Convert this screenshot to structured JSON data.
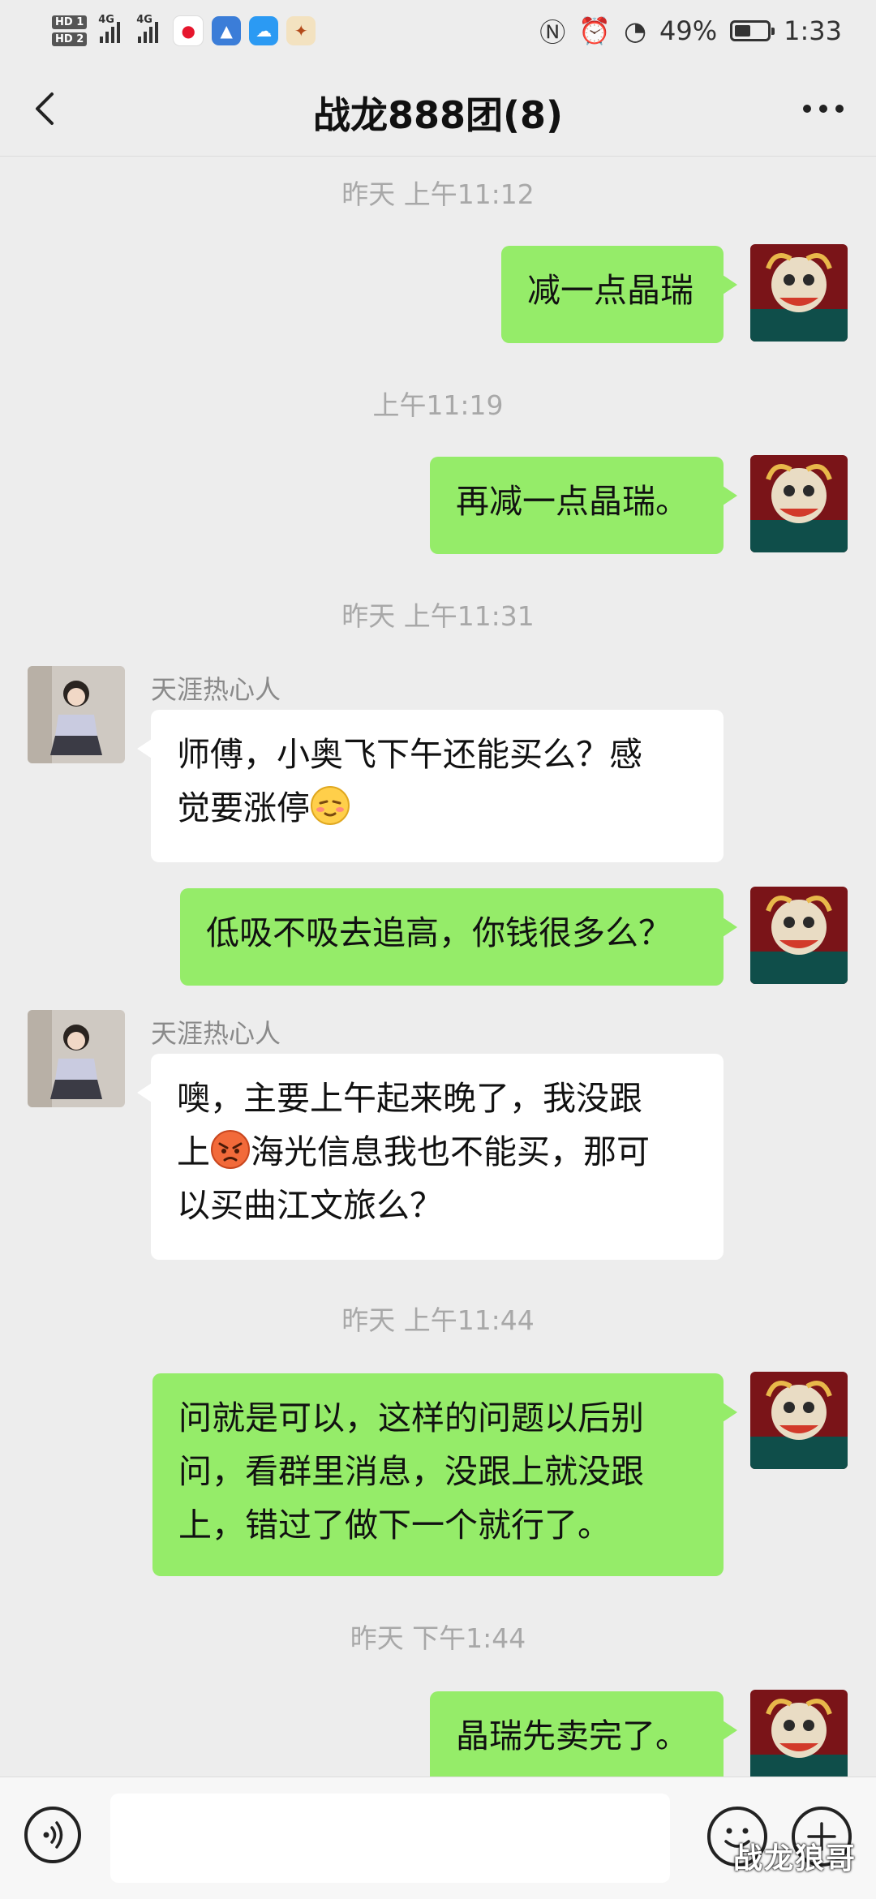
{
  "status_bar": {
    "hd1": "HD 1",
    "hd2": "HD 2",
    "net1": "4G",
    "net2": "4G",
    "battery_pct": "49%",
    "battery_level": 0.49,
    "time": "1:33"
  },
  "header": {
    "title": "战龙888团(8)"
  },
  "messages": [
    {
      "type": "time",
      "text": "昨天 上午11:12"
    },
    {
      "type": "me",
      "text": "减一点晶瑞"
    },
    {
      "type": "time",
      "text": "上午11:19"
    },
    {
      "type": "me",
      "text": "再减一点晶瑞。"
    },
    {
      "type": "time",
      "text": "昨天 上午11:31"
    },
    {
      "type": "other",
      "sender": "天涯热心人",
      "line1": "师傅，小奥飞下午还能买么？感",
      "line2": "觉要涨停"
    },
    {
      "type": "me",
      "text": "低吸不吸去追高，你钱很多么？"
    },
    {
      "type": "other",
      "sender": "天涯热心人",
      "line1": "噢，主要上午起来晚了，我没跟",
      "line2a": "上",
      "line2b": "海光信息我也不能买，那可",
      "line3": "以买曲江文旅么？"
    },
    {
      "type": "time",
      "text": "昨天 上午11:44"
    },
    {
      "type": "me",
      "line1": "问就是可以，这样的问题以后别",
      "line2": "问，看群里消息，没跟上就没跟",
      "line3": "上，错过了做下一个就行了。"
    },
    {
      "type": "time",
      "text": "昨天 下午1:44"
    },
    {
      "type": "me",
      "text": "晶瑞先卖完了。"
    }
  ],
  "watermark": "战龙狼哥",
  "colors": {
    "my_bubble": "#95ec69",
    "other_bubble": "#ffffff",
    "background": "#ededed"
  }
}
